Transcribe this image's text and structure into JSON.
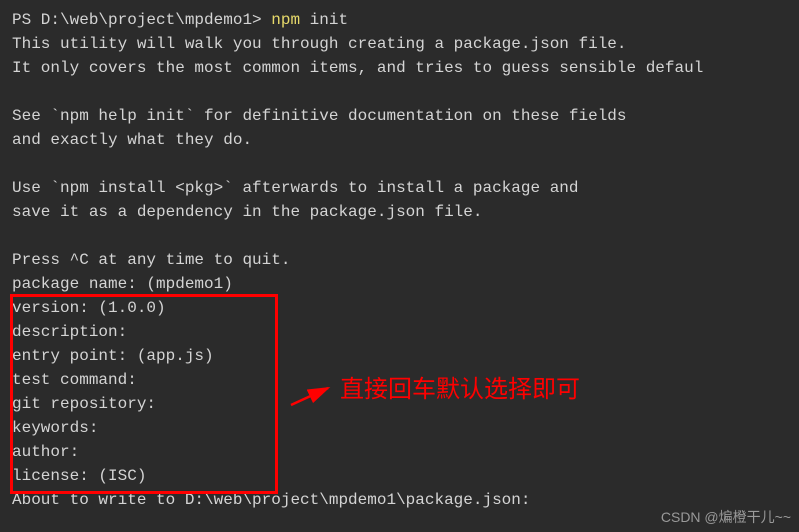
{
  "prompt": {
    "path": "PS D:\\web\\project\\mpdemo1> ",
    "cmd_highlight": "npm",
    "cmd_rest": " init"
  },
  "output": {
    "line1": "This utility will walk you through creating a package.json file.",
    "line2": "It only covers the most common items, and tries to guess sensible defaul",
    "line3": "",
    "line4": "See `npm help init` for definitive documentation on these fields",
    "line5": "and exactly what they do.",
    "line6": "",
    "line7": "Use `npm install <pkg>` afterwards to install a package and",
    "line8": "save it as a dependency in the package.json file.",
    "line9": "",
    "line10": "Press ^C at any time to quit."
  },
  "prompts": {
    "p1": "package name: (mpdemo1)",
    "p2": "version: (1.0.0)",
    "p3": "description:",
    "p4": "entry point: (app.js)",
    "p5": "test command:",
    "p6": "git repository:",
    "p7": "keywords:",
    "p8": "author:",
    "p9": "license: (ISC)"
  },
  "footer": "About to write to D:\\web\\project\\mpdemo1\\package.json:",
  "annotation": "直接回车默认选择即可",
  "watermark": "CSDN @煸橙干儿~~"
}
